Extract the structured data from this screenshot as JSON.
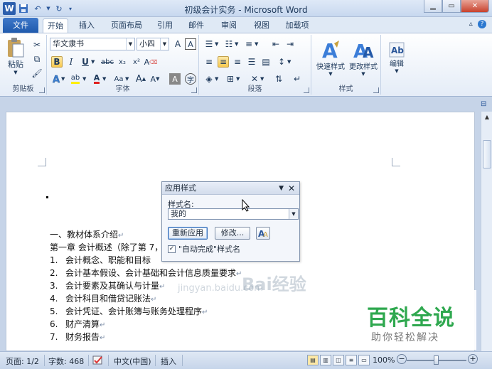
{
  "window": {
    "title": "初级会计实务 - Microsoft Word",
    "app_logo": "W"
  },
  "tabs": {
    "file": "文件",
    "items": [
      "开始",
      "插入",
      "页面布局",
      "引用",
      "邮件",
      "审阅",
      "视图",
      "加载项"
    ],
    "active_index": 0
  },
  "ribbon": {
    "clipboard": {
      "label": "剪贴板",
      "paste": "粘贴"
    },
    "font": {
      "label": "字体",
      "font_name": "华文隶书",
      "font_size": "小四",
      "bold": "B",
      "italic": "I",
      "underline": "U",
      "strike": "abc",
      "sub": "x₂",
      "sup": "x²",
      "case": "Aa",
      "grow": "A",
      "shrink": "A",
      "clear": "A",
      "phonetic": "A",
      "enclose": "字",
      "highlight": "ab",
      "color": "A",
      "border": "A"
    },
    "paragraph": {
      "label": "段落"
    },
    "styles": {
      "label": "样式",
      "quick": "快速样式",
      "change": "更改样式"
    },
    "editing": {
      "label": "编辑",
      "icon_text": "A"
    }
  },
  "dialog": {
    "title": "应用样式",
    "field_label": "样式名:",
    "field_value": "我的",
    "reapply": "重新应用",
    "modify": "修改...",
    "autocomplete": "\"自动完成\"样式名"
  },
  "document": {
    "lines": [
      {
        "num": "",
        "text": "一、教材体系介绍"
      },
      {
        "num": "",
        "text": "第一章 会计概述（除了第 7，"
      },
      {
        "num": "1.",
        "text": "会计概念、职能和目标"
      },
      {
        "num": "2.",
        "text": "会计基本假设、会计基础和会计信息质量要求"
      },
      {
        "num": "3.",
        "text": "会计要素及其确认与计量"
      },
      {
        "num": "4.",
        "text": "会计科目和借贷记账法"
      },
      {
        "num": "5.",
        "text": "会计凭证、会计账簿与账务处理程序"
      },
      {
        "num": "6.",
        "text": "财产清算"
      },
      {
        "num": "7.",
        "text": "财务报告"
      }
    ],
    "para_mark": "↵"
  },
  "watermark": {
    "text": "Bai经验",
    "url": "jingyan.baidu.com",
    "brand_big": "百科全说",
    "brand_small": "助你轻松解决"
  },
  "statusbar": {
    "page": "页面: 1/2",
    "words": "字数: 468",
    "language": "中文(中国)",
    "mode": "插入",
    "zoom": "100%",
    "zoom_out": "−",
    "zoom_in": "+"
  }
}
